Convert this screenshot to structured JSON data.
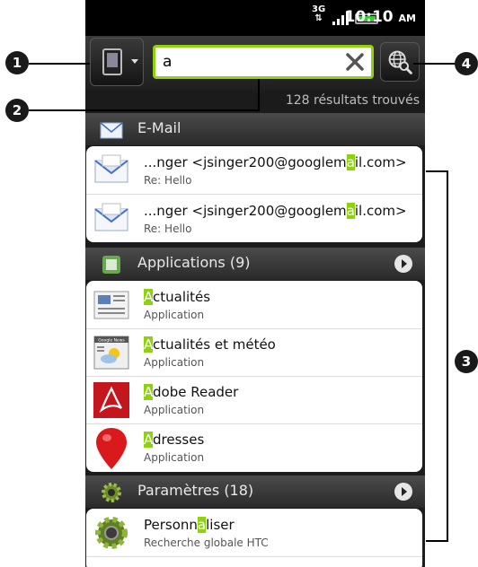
{
  "status_bar": {
    "network": "3G",
    "time": "10:10",
    "time_suffix": "AM"
  },
  "search": {
    "value": "a",
    "results_count": "128 résultats trouvés"
  },
  "sections": [
    {
      "title": "E-Mail",
      "has_more": false,
      "icon": "email-icon",
      "items": [
        {
          "title_pre": "...nger <jsinger200@googlem",
          "title_hl": "a",
          "title_post": "il.com>",
          "subtitle": "Re: Hello",
          "icon": "email-envelope-icon"
        },
        {
          "title_pre": "...nger <jsinger200@googlem",
          "title_hl": "a",
          "title_post": "il.com>",
          "subtitle": "Re: Hello",
          "icon": "email-envelope-icon"
        }
      ]
    },
    {
      "title": "Applications (9)",
      "has_more": true,
      "icon": "applications-icon",
      "items": [
        {
          "title_pre": "",
          "title_hl": "A",
          "title_post": "ctualités",
          "subtitle": "Application",
          "icon": "news-app-icon"
        },
        {
          "title_pre": "",
          "title_hl": "A",
          "title_post": "ctualités et météo",
          "subtitle": "Application",
          "icon": "news-weather-app-icon",
          "icon_text": "Google News"
        },
        {
          "title_pre": "",
          "title_hl": "A",
          "title_post": "dobe Reader",
          "subtitle": "Application",
          "icon": "adobe-reader-icon"
        },
        {
          "title_pre": "",
          "title_hl": "A",
          "title_post": "dresses",
          "subtitle": "Application",
          "icon": "maps-pin-icon"
        }
      ]
    },
    {
      "title": "Paramètres (18)",
      "has_more": true,
      "icon": "settings-gear-icon",
      "items": [
        {
          "title_pre": "Personn",
          "title_hl": "a",
          "title_post": "liser",
          "subtitle": "Recherche globale HTC",
          "icon": "settings-gear-icon"
        }
      ]
    }
  ],
  "callouts": [
    "1",
    "2",
    "3",
    "4"
  ],
  "colors": {
    "highlight": "#8fd10f",
    "background": "#1c1c1c",
    "card": "#ffffff"
  }
}
